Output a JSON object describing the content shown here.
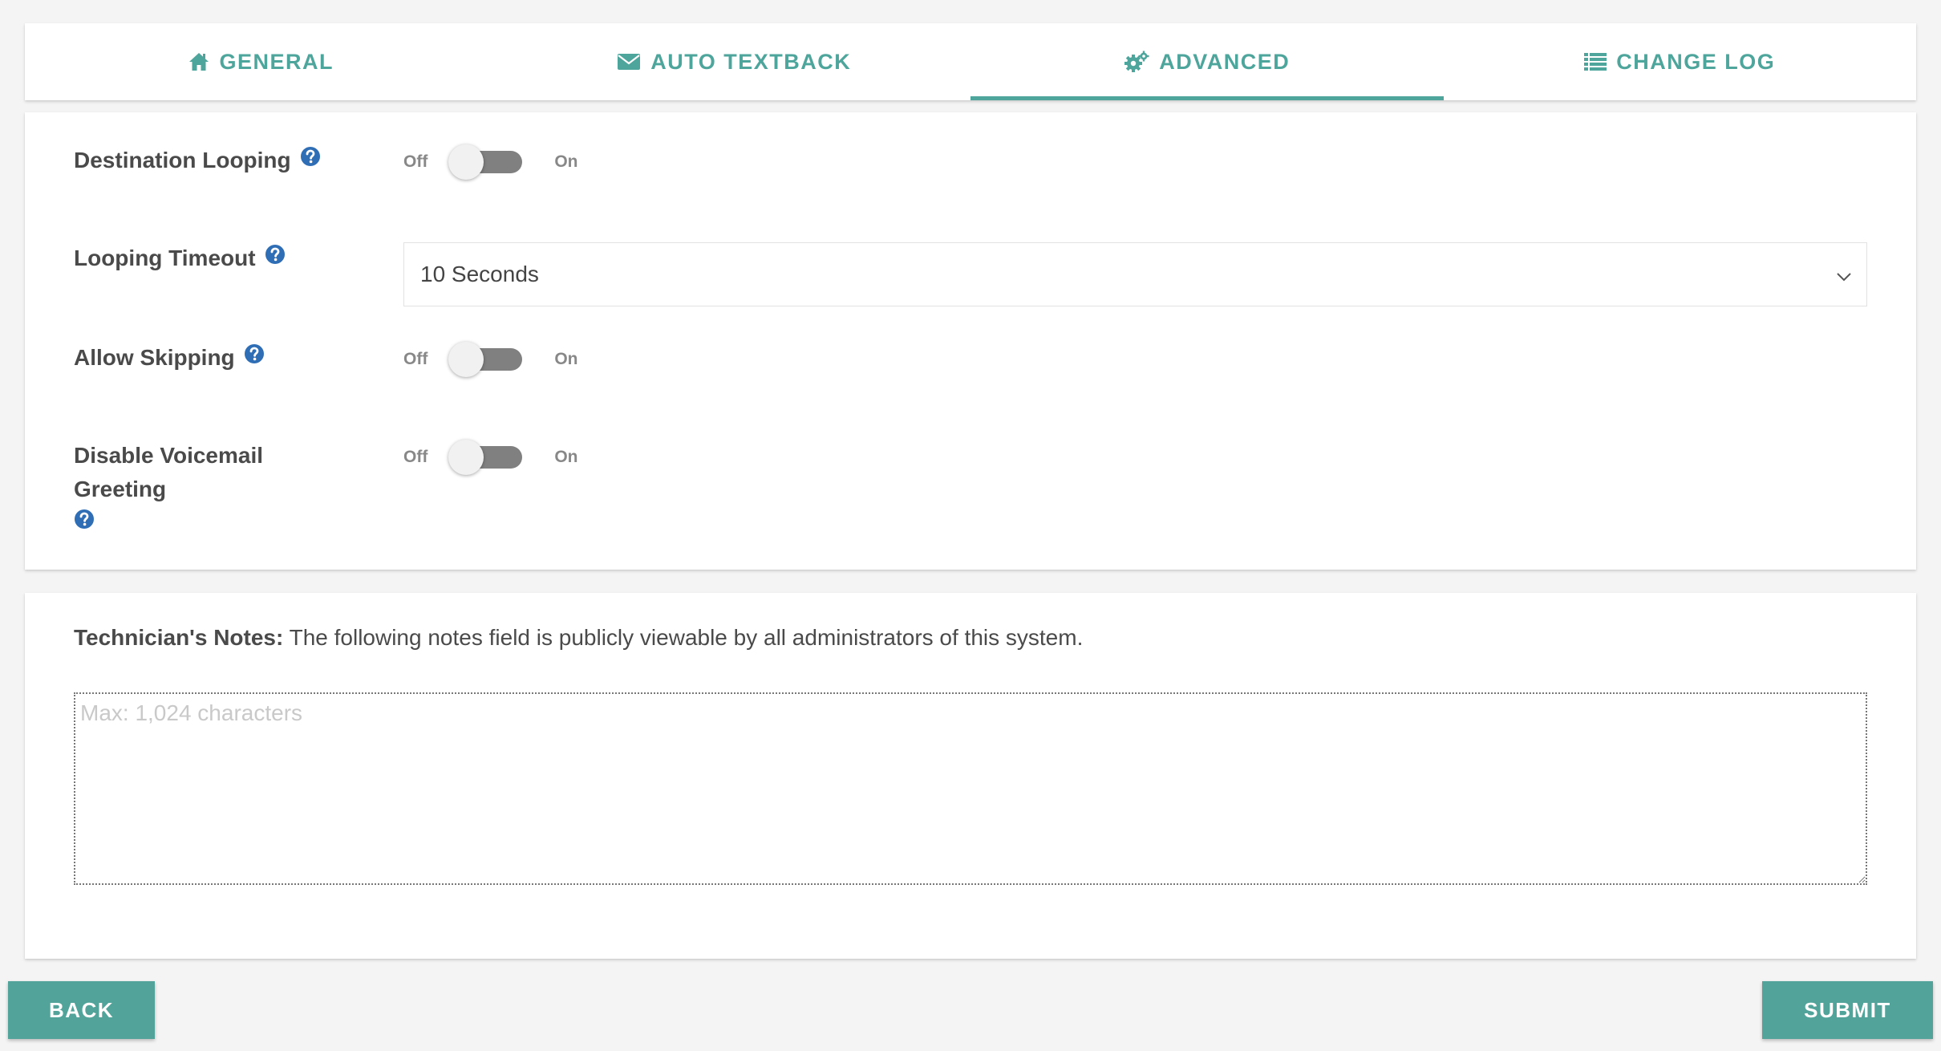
{
  "tabs": [
    {
      "label": "GENERAL",
      "icon": "home-icon",
      "active": false
    },
    {
      "label": "AUTO TEXTBACK",
      "icon": "envelope-icon",
      "active": false
    },
    {
      "label": "ADVANCED",
      "icon": "gears-icon",
      "active": true
    },
    {
      "label": "CHANGE LOG",
      "icon": "list-icon",
      "active": false
    }
  ],
  "settings": {
    "destination_looping": {
      "label": "Destination Looping",
      "off_label": "Off",
      "on_label": "On",
      "value": false
    },
    "looping_timeout": {
      "label": "Looping Timeout",
      "selected": "10 Seconds"
    },
    "allow_skipping": {
      "label": "Allow Skipping",
      "off_label": "Off",
      "on_label": "On",
      "value": false
    },
    "disable_voicemail_greeting": {
      "label": "Disable Voicemail Greeting",
      "off_label": "Off",
      "on_label": "On",
      "value": false
    }
  },
  "notes": {
    "heading": "Technician's Notes:",
    "description": "The following notes field is publicly viewable by all administrators of this system.",
    "placeholder": "Max: 1,024 characters",
    "value": ""
  },
  "buttons": {
    "back_label": "BACK",
    "submit_label": "SUBMIT"
  },
  "colors": {
    "accent": "#4ea59b",
    "help_icon": "#2f6eb5",
    "toggle_track": "#808080"
  }
}
